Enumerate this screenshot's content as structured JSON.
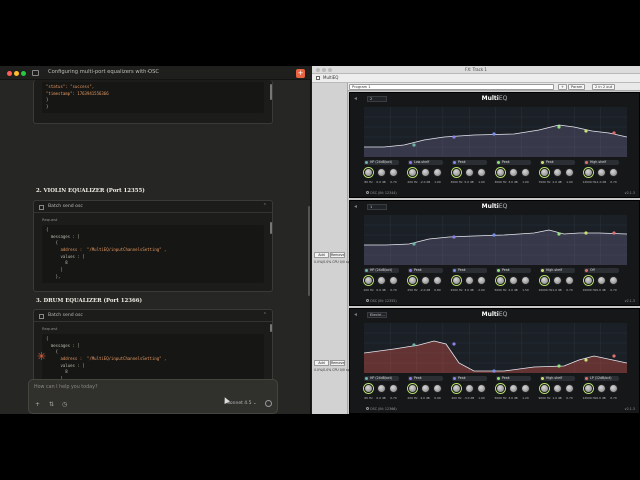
{
  "chat": {
    "title": "Configuring multi-port equalizers with OSC",
    "top_response": [
      "\"status\": \"success\",",
      "\"timestamp\": 1763941556366",
      "}",
      "}"
    ],
    "sections": [
      {
        "heading": "2. VIOLIN EQUALIZER (Port 12355)",
        "card_title": "Batch send osc",
        "request_label": "Request",
        "code": [
          "{",
          "  messages : [",
          "    {",
          "      address :  \"/MultiEQ/inputChannelsSetting\" ,",
          "      values : [",
          "        8",
          "      ]",
          "    },"
        ]
      },
      {
        "heading": "3. DRUM EQUALIZER (Port 12366)",
        "card_title": "Batch send osc",
        "request_label": "Request",
        "code": [
          "{",
          "  messages : [",
          "    {",
          "      address :  \"/MultiEQ/inputChannelsSetting\" ,",
          "      values : [",
          "        8",
          "      ]",
          "    },"
        ]
      }
    ],
    "composer_placeholder": "How can I help you today?",
    "model": "Sonnet 4.5",
    "icons": [
      "plus-icon",
      "tools-icon",
      "clock-icon",
      "send-icon"
    ]
  },
  "host": {
    "window_title": "FX: Track 1",
    "tab": "MultiEQ",
    "preset": "Program 1",
    "preset_buttons": [
      "+",
      "Param",
      "2 in 2 out"
    ],
    "strip": {
      "add_label": "Add",
      "remove_label": "Remove",
      "cpu_label": "0.0%/0.0% CPU 0/0 spls"
    },
    "plugin_name_bold": "Multi",
    "plugin_name_light": "EQ",
    "version": "v2.1.3"
  },
  "eqs": [
    {
      "name": "violin-eq",
      "program": "2",
      "osc_label": "OSC (IN: 12344)",
      "color": "#b7a9f0",
      "bands": [
        {
          "type": "HP (24dB/oct)",
          "color": "#6fb3a7",
          "values": [
            "80 Hz",
            "0.0 dB",
            "0.70"
          ]
        },
        {
          "type": "Low-shelf",
          "color": "#8f7fe8",
          "values": [
            "200 Hz",
            "-2.0 dB",
            "1.00"
          ]
        },
        {
          "type": "Peak",
          "color": "#7a8fe8",
          "values": [
            "3000 Hz",
            "5.0 dB",
            "1.00"
          ]
        },
        {
          "type": "Peak",
          "color": "#8fe07a",
          "values": [
            "3000 Hz",
            "3.0 dB",
            "1.00"
          ]
        },
        {
          "type": "Peak",
          "color": "#d0e070",
          "values": [
            "7000 Hz",
            "2.0 dB",
            "1.00"
          ]
        },
        {
          "type": "High-shelf",
          "color": "#e07070",
          "values": [
            "12000 Hz",
            "-1.0 dB",
            "0.70"
          ]
        }
      ]
    },
    {
      "name": "drum-eq",
      "program": "1",
      "osc_label": "OSC (IN: 12355)",
      "color": "#b7a9f0",
      "bands": [
        {
          "type": "HP (24dB/oct)",
          "color": "#6fb3a7",
          "values": [
            "100 Hz",
            "0.0 dB",
            "0.70"
          ]
        },
        {
          "type": "Peak",
          "color": "#8f7fe8",
          "values": [
            "250 Hz",
            "-2.0 dB",
            "0.80"
          ]
        },
        {
          "type": "Peak",
          "color": "#7a8fe8",
          "values": [
            "2500 Hz",
            "3.0 dB",
            "2.00"
          ]
        },
        {
          "type": "Peak",
          "color": "#8fe07a",
          "values": [
            "5000 Hz",
            "2.0 dB",
            "1.50"
          ]
        },
        {
          "type": "High-shelf",
          "color": "#d0e070",
          "values": [
            "10000 Hz",
            "1.0 dB",
            "0.70"
          ]
        },
        {
          "type": "Off",
          "color": "#e07070",
          "values": [
            "10000 Hz",
            "0.0 dB",
            "0.70"
          ]
        }
      ]
    },
    {
      "name": "electric-eq",
      "program": "Electri...",
      "osc_label": "OSC (IN: 12366)",
      "color": "#e85a4a",
      "bands": [
        {
          "type": "HP (24dB/oct)",
          "color": "#6fb3a7",
          "values": [
            "60 Hz",
            "0.0 dB",
            "0.70"
          ]
        },
        {
          "type": "Peak",
          "color": "#8f7fe8",
          "values": [
            "200 Hz",
            "4.0 dB",
            "0.90"
          ]
        },
        {
          "type": "Peak",
          "color": "#7a8fe8",
          "values": [
            "400 Hz",
            "-3.0 dB",
            "1.00"
          ]
        },
        {
          "type": "Peak",
          "color": "#8fe07a",
          "values": [
            "5000 Hz",
            "3.0 dB",
            "1.20"
          ]
        },
        {
          "type": "High-shelf",
          "color": "#d0e070",
          "values": [
            "9000 Hz",
            "1.0 dB",
            "0.70"
          ]
        },
        {
          "type": "LP (12dB/oct)",
          "color": "#e07070",
          "values": [
            "12000 Hz",
            "0.0 dB",
            "0.70"
          ]
        }
      ]
    }
  ]
}
